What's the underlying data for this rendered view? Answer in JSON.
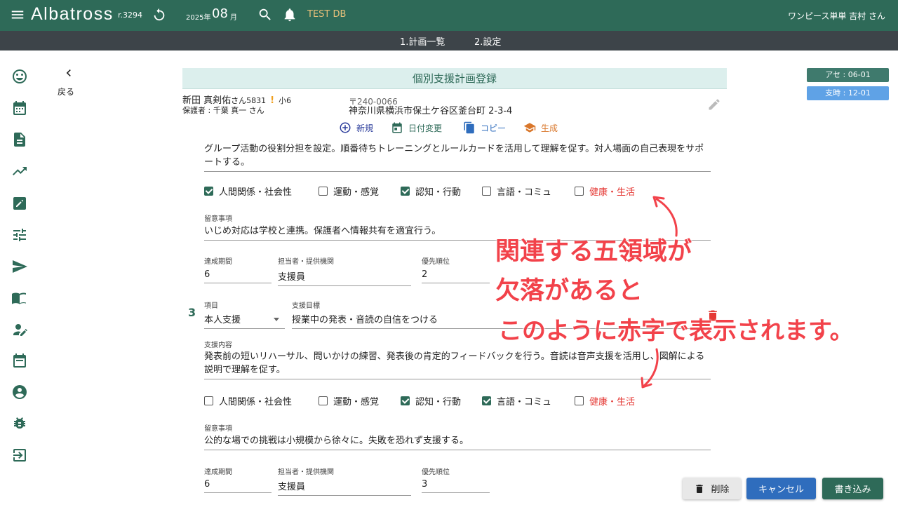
{
  "header": {
    "app_name": "Albatross",
    "revision": "r.3294",
    "year_label": "2025年",
    "month": "08",
    "month_suffix": "月",
    "db": "TEST DB",
    "user": "ワンピース単単 吉村 さん"
  },
  "nav": [
    "1.計画一覧",
    "2.設定"
  ],
  "sidebar_icons": [
    "smiley-icon",
    "calendar-icon",
    "document-icon",
    "trending-icon",
    "edit-note-icon",
    "tune-icon",
    "send-icon",
    "book-icon",
    "person-edit-icon",
    "event-icon",
    "account-circle-icon",
    "bug-icon",
    "logout-icon"
  ],
  "back": {
    "label": "戻る"
  },
  "badges": {
    "a": "アセ : 06-01",
    "b": "支時 : 12-01"
  },
  "form_title": "個別支援計画登録",
  "person": {
    "name": "新田 真剣佑",
    "san": "さん5831",
    "warn": "!",
    "grade": "小6",
    "guardian": "保護者 : 千葉 真一 さん",
    "postal": "〒240-0066",
    "address": "神奈川県横浜市保土ケ谷区釜台町 2-3-4"
  },
  "actions": {
    "new": "新規",
    "date_change": "日付変更",
    "copy": "コピー",
    "generate": "生成"
  },
  "item2": {
    "content": "グループ活動の役割分担を設定。順番待ちトレーニングとルールカードを活用して理解を促す。対人場面の自己表現をサポートする。",
    "checks": [
      {
        "label": "人間関係・社会性",
        "checked": true
      },
      {
        "label": "運動・感覚",
        "checked": false
      },
      {
        "label": "認知・行動",
        "checked": true
      },
      {
        "label": "言語・コミュ",
        "checked": false
      },
      {
        "label": "健康・生活",
        "checked": false,
        "missing": true
      }
    ],
    "notes_label": "留意事項",
    "notes": "いじめ対応は学校と連携。保護者へ情報共有を適宜行う。",
    "period_label": "達成期間",
    "period": "6",
    "staff_label": "担当者・提供機関",
    "staff": "支援員",
    "priority_label": "優先順位",
    "priority": "2"
  },
  "item3": {
    "number": "3",
    "category_label": "項目",
    "category": "本人支援",
    "goal_label": "支援目標",
    "goal": "授業中の発表・音読の自信をつける",
    "content_label": "支援内容",
    "content": "発表前の短いリハーサル、問いかけの練習、発表後の肯定的フィードバックを行う。音読は音声支援を活用し、図解による説明で理解を促す。",
    "checks": [
      {
        "label": "人間関係・社会性",
        "checked": false
      },
      {
        "label": "運動・感覚",
        "checked": false
      },
      {
        "label": "認知・行動",
        "checked": true
      },
      {
        "label": "言語・コミュ",
        "checked": true
      },
      {
        "label": "健康・生活",
        "checked": false,
        "missing": true
      }
    ],
    "notes_label": "留意事項",
    "notes": "公的な場での挑戦は小規模から徐々に。失敗を恐れず支援する。",
    "period_label": "達成期間",
    "period": "6",
    "staff_label": "担当者・提供機関",
    "staff": "支援員",
    "priority_label": "優先順位",
    "priority": "3"
  },
  "annotation": [
    "関連する五領域が",
    "欠落があると",
    "このように赤字で表示されます。"
  ],
  "buttons": {
    "delete": "削除",
    "cancel": "キャンセル",
    "write": "書き込み"
  },
  "colors": {
    "primary": "#2e6a58",
    "navbar": "#3d4449",
    "accent_red": "#e53935",
    "cancel_blue": "#2f6dbd"
  }
}
